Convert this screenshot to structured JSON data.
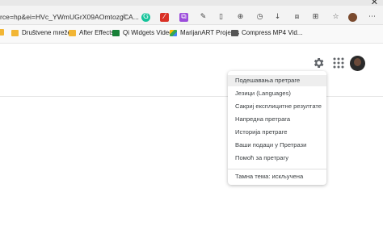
{
  "browser": {
    "url_fragment": "rce=hp&ei=HVc_YWmUGrX09AOmtozgCA...",
    "toolbar_icons": [
      "tab-search-icon",
      "grammarly-icon",
      "pdf-icon",
      "extension-icon",
      "puzzle-icon",
      "split-screen-icon",
      "collections-icon",
      "history-icon",
      "downloads-icon",
      "screenshot-icon",
      "profile-icon",
      "more-icon"
    ]
  },
  "bookmarks": [
    {
      "label": "",
      "icon": "folder"
    },
    {
      "label": "Društvene mreže",
      "icon": "folder"
    },
    {
      "label": "After Effects",
      "icon": "folder"
    },
    {
      "label": "Qi Widgets Videos",
      "icon": "app"
    },
    {
      "label": "MarijanART Projects",
      "icon": "drive"
    },
    {
      "label": "Compress MP4 Vid...",
      "icon": "film"
    }
  ],
  "settings_menu": {
    "items": [
      "Подешавања претраге",
      "Језици (Languages)",
      "Сакриј експлицитне резултате",
      "Напредна претрага",
      "Историја претраге",
      "Ваши подаци у Претрази",
      "Помоћ за претрагу"
    ],
    "theme_item": "Тамна тема: искључена",
    "highlighted_index": 0
  },
  "colors": {
    "toolbar_bg": "#f3f3f3",
    "menu_hover": "#eeeeee",
    "text": "#3c4043"
  }
}
